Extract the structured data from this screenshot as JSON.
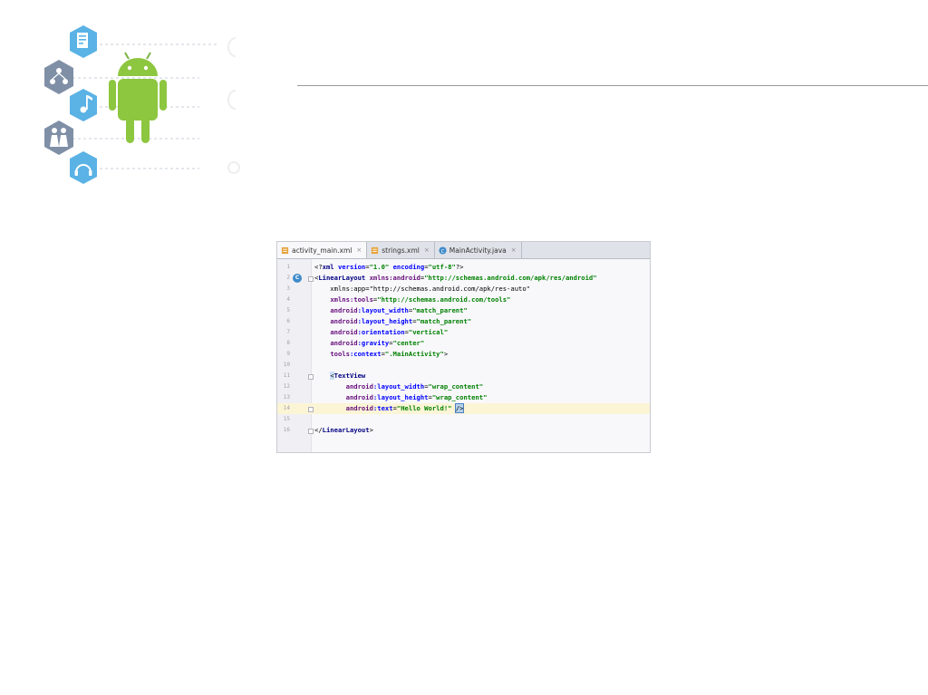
{
  "tabs": [
    {
      "label": "activity_main.xml",
      "icon": "xml-file-icon",
      "active": true
    },
    {
      "label": "strings.xml",
      "icon": "xml-file-icon",
      "active": false
    },
    {
      "label": "MainActivity.java",
      "icon": "java-class-icon",
      "active": false
    }
  ],
  "gutter_badge": "C",
  "colors": {
    "android_green": "#8dc63f",
    "hex_blue": "#5ab2e5",
    "hex_gray": "#7f8fa6"
  },
  "lines": [
    {
      "n": "1",
      "parts": [
        [
          "pl",
          "<?"
        ],
        [
          "tg",
          "xml"
        ],
        [
          "pl",
          " "
        ],
        [
          "at",
          "version"
        ],
        [
          "pl",
          "="
        ],
        [
          "vl",
          "\"1.0\""
        ],
        [
          "pl",
          " "
        ],
        [
          "at",
          "encoding"
        ],
        [
          "pl",
          "="
        ],
        [
          "vl",
          "\"utf-8\""
        ],
        [
          "pl",
          "?>"
        ]
      ]
    },
    {
      "n": "2",
      "parts": [
        [
          "pl",
          "<"
        ],
        [
          "tg",
          "LinearLayout"
        ],
        [
          "pl",
          " "
        ],
        [
          "ns",
          "xmlns:android"
        ],
        [
          "pl",
          "="
        ],
        [
          "vl",
          "\"http://schemas.android.com/apk/res/android\""
        ]
      ]
    },
    {
      "n": "3",
      "parts": [
        [
          "pl",
          "    xmlns:app=\"http://schemas.android.com/apk/res-auto\""
        ]
      ]
    },
    {
      "n": "4",
      "parts": [
        [
          "pl",
          "    "
        ],
        [
          "ns",
          "xmlns:tools"
        ],
        [
          "pl",
          "="
        ],
        [
          "vl",
          "\"http://schemas.android.com/tools\""
        ]
      ]
    },
    {
      "n": "5",
      "parts": [
        [
          "pl",
          "    "
        ],
        [
          "ns",
          "android"
        ],
        [
          "at",
          ":layout_width"
        ],
        [
          "pl",
          "="
        ],
        [
          "vl",
          "\"match_parent\""
        ]
      ]
    },
    {
      "n": "6",
      "parts": [
        [
          "pl",
          "    "
        ],
        [
          "ns",
          "android"
        ],
        [
          "at",
          ":layout_height"
        ],
        [
          "pl",
          "="
        ],
        [
          "vl",
          "\"match_parent\""
        ]
      ]
    },
    {
      "n": "7",
      "parts": [
        [
          "pl",
          "    "
        ],
        [
          "ns",
          "android"
        ],
        [
          "at",
          ":orientation"
        ],
        [
          "pl",
          "="
        ],
        [
          "vl",
          "\"vertical\""
        ]
      ]
    },
    {
      "n": "8",
      "parts": [
        [
          "pl",
          "    "
        ],
        [
          "ns",
          "android"
        ],
        [
          "at",
          ":gravity"
        ],
        [
          "pl",
          "="
        ],
        [
          "vl",
          "\"center\""
        ]
      ]
    },
    {
      "n": "9",
      "parts": [
        [
          "pl",
          "    "
        ],
        [
          "ns",
          "tools"
        ],
        [
          "at",
          ":context"
        ],
        [
          "pl",
          "="
        ],
        [
          "vl",
          "\".MainActivity\""
        ],
        [
          "pl",
          ">"
        ]
      ]
    },
    {
      "n": "10",
      "parts": []
    },
    {
      "n": "11",
      "parts": [
        [
          "pl",
          "    "
        ],
        [
          "mark",
          "<"
        ],
        [
          "tg",
          "TextView"
        ]
      ]
    },
    {
      "n": "12",
      "parts": [
        [
          "pl",
          "        "
        ],
        [
          "ns",
          "android"
        ],
        [
          "at",
          ":layout_width"
        ],
        [
          "pl",
          "="
        ],
        [
          "vl",
          "\"wrap_content\""
        ]
      ]
    },
    {
      "n": "13",
      "parts": [
        [
          "pl",
          "        "
        ],
        [
          "ns",
          "android"
        ],
        [
          "at",
          ":layout_height"
        ],
        [
          "pl",
          "="
        ],
        [
          "vl",
          "\"wrap_content\""
        ]
      ]
    },
    {
      "n": "14",
      "parts": [
        [
          "pl",
          "        "
        ],
        [
          "ns",
          "android"
        ],
        [
          "at",
          ":text"
        ],
        [
          "pl",
          "="
        ],
        [
          "vl",
          "\"Hello World!\""
        ],
        [
          "pl",
          " "
        ],
        [
          "caret",
          "/>"
        ]
      ]
    },
    {
      "n": "15",
      "parts": []
    },
    {
      "n": "16",
      "parts": [
        [
          "pl",
          "</"
        ],
        [
          "tg",
          "LinearLayout"
        ],
        [
          "pl",
          ">"
        ]
      ]
    }
  ]
}
